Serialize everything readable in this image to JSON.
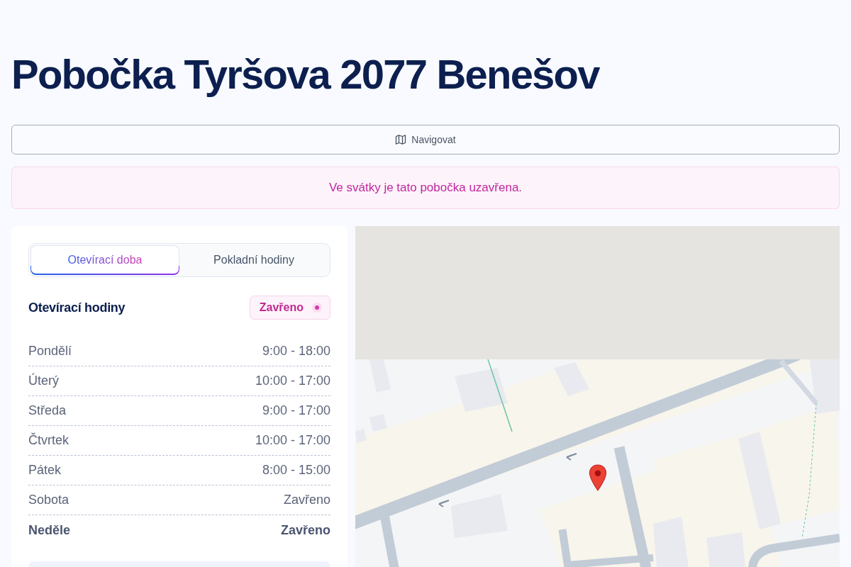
{
  "page": {
    "title": "Pobočka Tyršova 2077 Benešov"
  },
  "navigate_button": {
    "label": "Navigovat"
  },
  "notice": {
    "text": "Ve svátky je tato pobočka uzavřena."
  },
  "hours_card": {
    "tabs": [
      {
        "label": "Otevírací doba",
        "selected": true
      },
      {
        "label": "Pokladní hodiny",
        "selected": false
      }
    ],
    "heading": "Otevírací hodiny",
    "status": {
      "label": "Zavřeno",
      "open": false
    },
    "rows": [
      {
        "day": "Pondělí",
        "hours": "9:00 - 18:00",
        "today": false
      },
      {
        "day": "Úterý",
        "hours": "10:00 - 17:00",
        "today": false
      },
      {
        "day": "Středa",
        "hours": "9:00 - 17:00",
        "today": false
      },
      {
        "day": "Čtvrtek",
        "hours": "10:00 - 17:00",
        "today": false
      },
      {
        "day": "Pátek",
        "hours": "8:00 - 15:00",
        "today": false
      },
      {
        "day": "Sobota",
        "hours": "Zavřeno",
        "today": false
      },
      {
        "day": "Neděle",
        "hours": "Zavřeno",
        "today": true
      }
    ]
  }
}
